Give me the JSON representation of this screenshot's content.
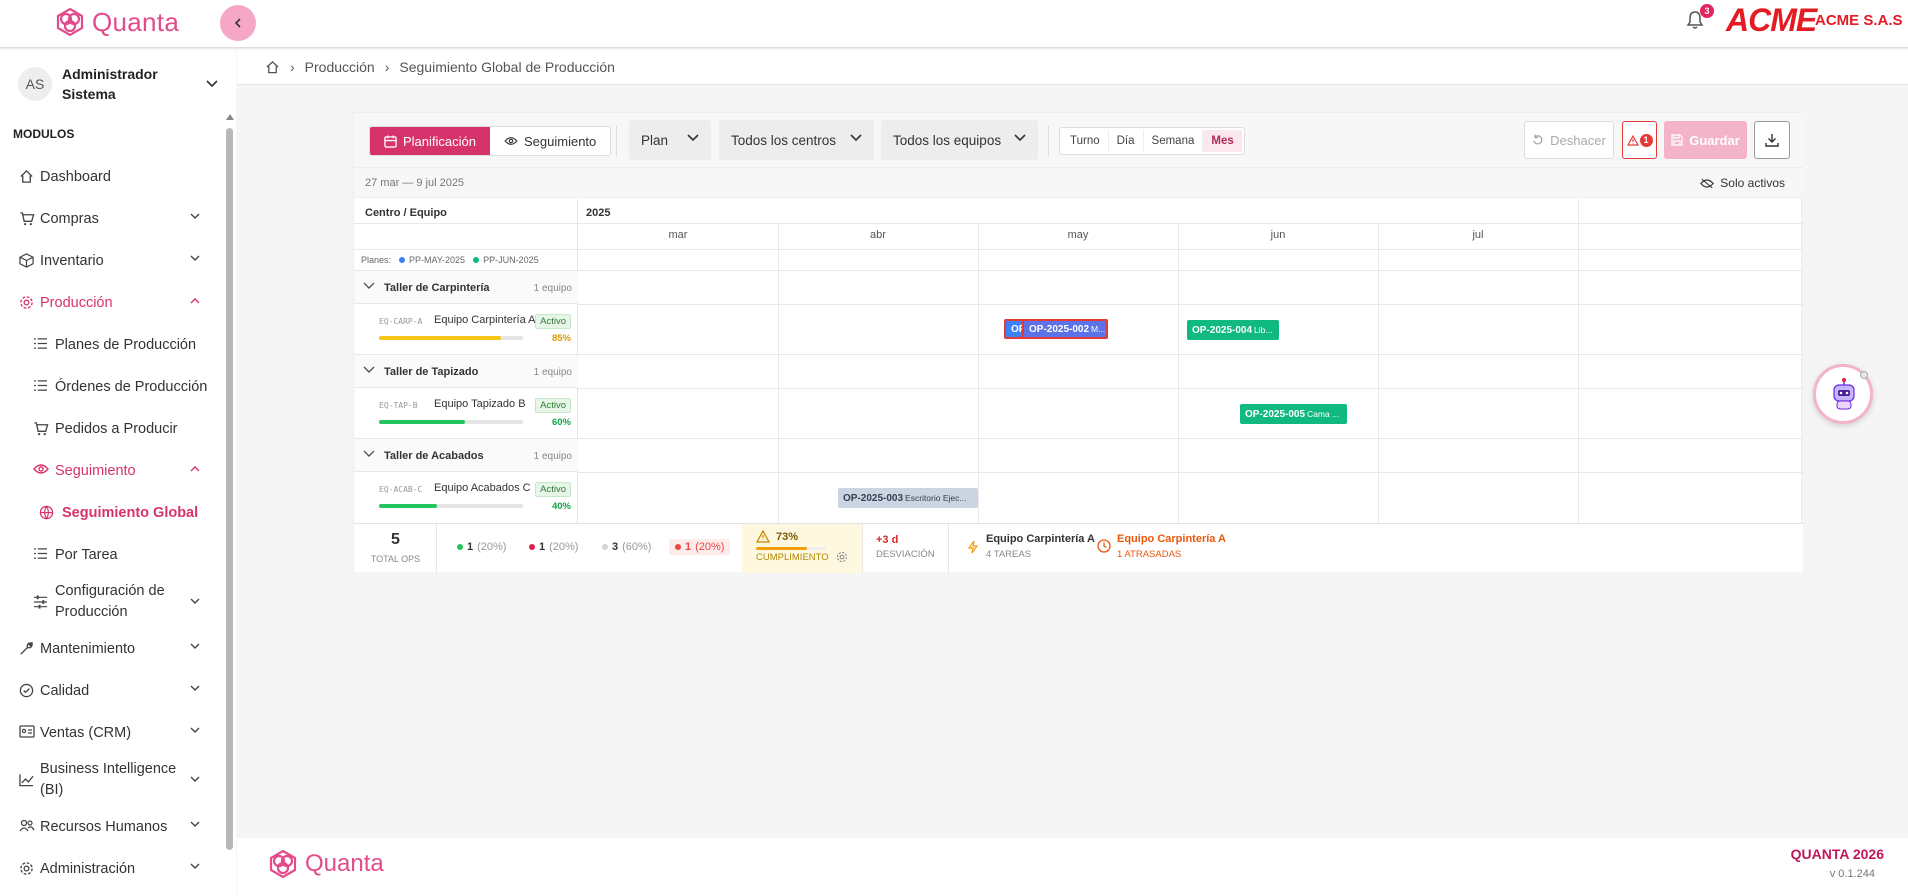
{
  "app": {
    "brand": "Quanta",
    "company": "ACME S.A.S",
    "company_logo": "ACME",
    "notifications": "3"
  },
  "user": {
    "initials": "AS",
    "name": "Administrador Sistema"
  },
  "sidebar": {
    "section_title": "MODULOS",
    "items": [
      {
        "label": "Dashboard",
        "icon": "home-icon"
      },
      {
        "label": "Compras",
        "icon": "cart-icon"
      },
      {
        "label": "Inventario",
        "icon": "box-icon"
      },
      {
        "label": "Producción",
        "icon": "gear-icon"
      },
      {
        "label": "Planes de Producción",
        "icon": "list-icon"
      },
      {
        "label": "Órdenes de Producción",
        "icon": "list-icon"
      },
      {
        "label": "Pedidos a Producir",
        "icon": "cart-icon"
      },
      {
        "label": "Seguimiento",
        "icon": "eye-icon"
      },
      {
        "label": "Seguimiento Global",
        "icon": "globe-icon"
      },
      {
        "label": "Por Tarea",
        "icon": "list-icon"
      },
      {
        "label": "Configuración de Producción",
        "icon": "sliders-icon"
      },
      {
        "label": "Mantenimiento",
        "icon": "wrench-icon"
      },
      {
        "label": "Calidad",
        "icon": "check-circle-icon"
      },
      {
        "label": "Ventas (CRM)",
        "icon": "id-card-icon"
      },
      {
        "label": "Business Intelligence (BI)",
        "icon": "chart-icon"
      },
      {
        "label": "Recursos Humanos",
        "icon": "people-icon"
      },
      {
        "label": "Administración",
        "icon": "gear-icon"
      }
    ]
  },
  "breadcrumb": {
    "items": [
      "Producción",
      "Seguimiento Global de Producción"
    ]
  },
  "toolbar": {
    "mode_planning": "Planificación",
    "mode_tracking": "Seguimiento",
    "plan_select": "Plan",
    "centers_select": "Todos los centros",
    "equipment_select": "Todos los equipos",
    "views": [
      "Turno",
      "Día",
      "Semana",
      "Mes"
    ],
    "active_view": "Mes",
    "undo": "Deshacer",
    "alerts": "1",
    "save": "Guardar"
  },
  "range": {
    "label": "27 mar — 9 jul 2025",
    "only_active": "Solo activos"
  },
  "gantt": {
    "left_header": "Centro / Equipo",
    "year": "2025",
    "months": [
      "mar",
      "abr",
      "may",
      "jun",
      "jul"
    ],
    "plans_label": "Planes:",
    "plans": [
      {
        "name": "PP-MAY-2025",
        "color": "#3b82f6"
      },
      {
        "name": "PP-JUN-2025",
        "color": "#10b981"
      }
    ],
    "groups": [
      {
        "name": "Taller de Carpintería",
        "count": "1 equipo",
        "equipment": {
          "code": "EQ-CARP-A",
          "name": "Equipo Carpintería A",
          "status": "Activo",
          "load": 85,
          "load_label": "85%",
          "color": "#f5c518",
          "pct_color": "#d99a00"
        }
      },
      {
        "name": "Taller de Tapizado",
        "count": "1 equipo",
        "equipment": {
          "code": "EQ-TAP-B",
          "name": "Equipo Tapizado B",
          "status": "Activo",
          "load": 60,
          "load_label": "60%",
          "color": "#22c55e",
          "pct_color": "#16a34a"
        }
      },
      {
        "name": "Taller de Acabados",
        "count": "1 equipo",
        "equipment": {
          "code": "EQ-ACAB-C",
          "name": "Equipo Acabados C",
          "status": "Activo",
          "load": 40,
          "load_label": "40%",
          "color": "#22c55e",
          "pct_color": "#16a34a"
        }
      }
    ],
    "ops": [
      {
        "code": "OP",
        "desc": "",
        "color": "#3b82f6",
        "outline": "#e53935"
      },
      {
        "code": "OP-2025-002",
        "desc": "M...",
        "color": "#5b72e8",
        "outline": "#e53935"
      },
      {
        "code": "OP-2025-004",
        "desc": "Lib...",
        "color": "#10b981",
        "outline": ""
      },
      {
        "code": "OP-2025-005",
        "desc": "Cama ...",
        "color": "#10b981",
        "outline": ""
      },
      {
        "code": "OP-2025-003",
        "desc": "Escritorio Ejec...",
        "color": "#cbd5e1",
        "outline": ""
      }
    ]
  },
  "summary": {
    "total": "5",
    "total_label": "TOTAL OPS",
    "stats": [
      {
        "n": "1",
        "pct": "(20%)",
        "color": "#22c55e"
      },
      {
        "n": "1",
        "pct": "(20%)",
        "color": "#e11d48"
      },
      {
        "n": "3",
        "pct": "(60%)",
        "color": "#d4d4d4"
      },
      {
        "n": "1",
        "pct": "(20%)",
        "color": "#ef4444"
      }
    ],
    "compliance": "73%",
    "compliance_value": 73,
    "compliance_label": "CUMPLIMIENTO",
    "deviation": "+3 d",
    "deviation_label": "DESVIACIÓN",
    "bottleneck": "Equipo Carpintería A",
    "bottleneck_sub": "4 TAREAS",
    "late": "Equipo Carpintería A",
    "late_sub": "1 ATRASADAS"
  },
  "footer": {
    "brand": "Quanta",
    "right_title": "QUANTA 2026",
    "version": "v 0.1.244"
  }
}
